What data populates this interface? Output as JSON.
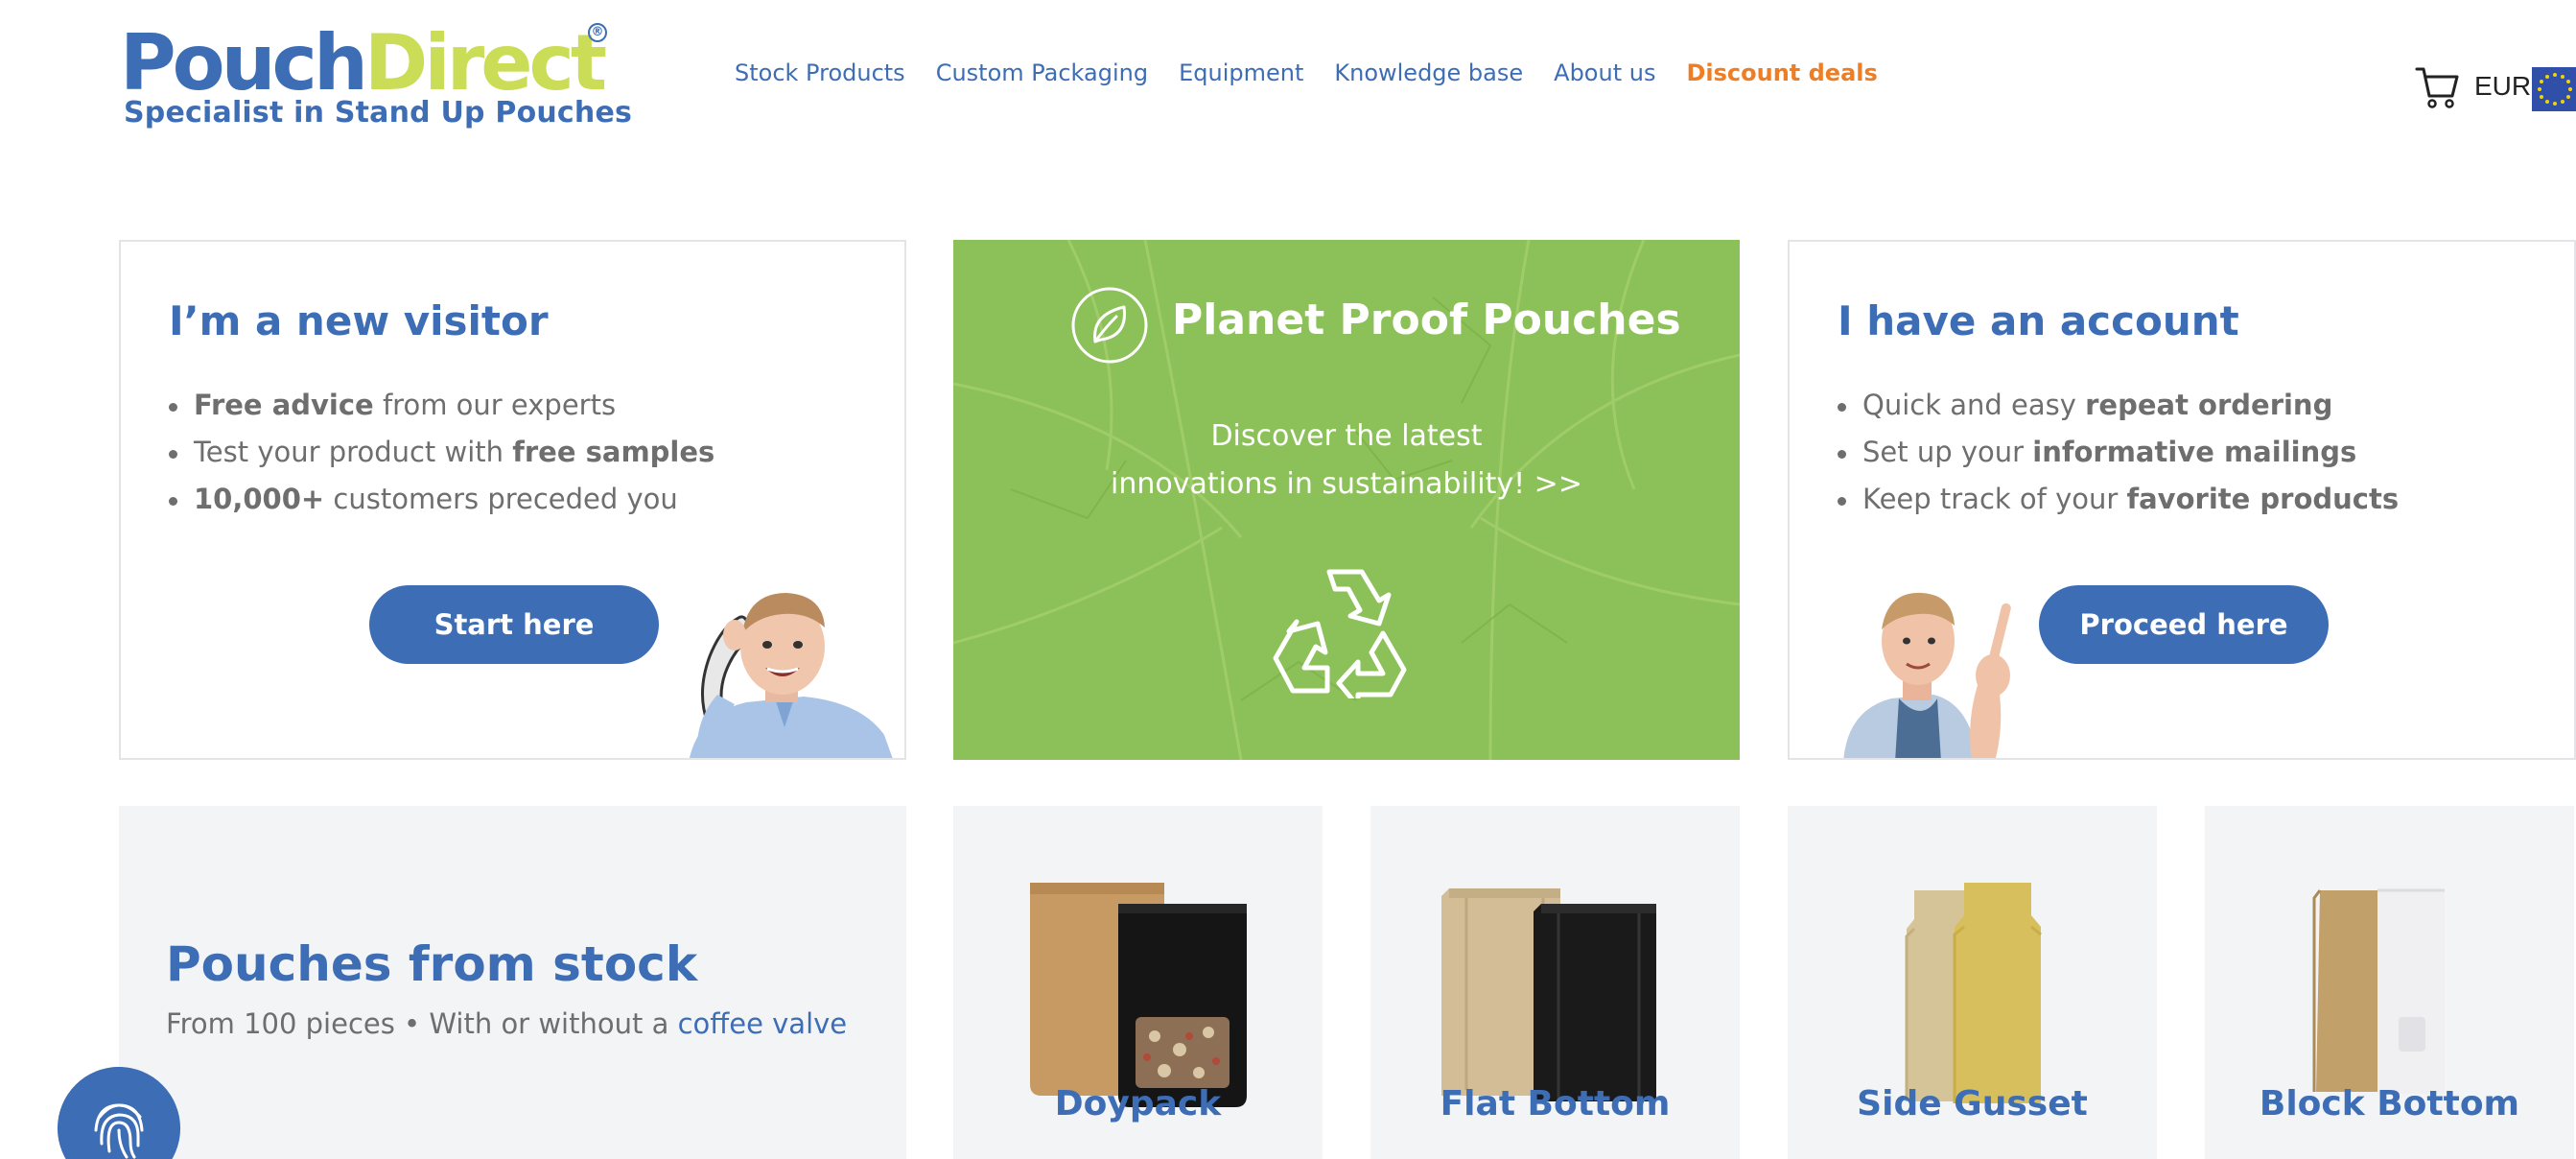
{
  "header": {
    "logo": {
      "word1": "Pouch",
      "word2": "Direct",
      "registered": "®",
      "tagline": "Specialist in Stand Up Pouches"
    },
    "nav": [
      {
        "label": "Stock Products"
      },
      {
        "label": "Custom Packaging"
      },
      {
        "label": "Equipment"
      },
      {
        "label": "Knowledge base"
      },
      {
        "label": "About us"
      },
      {
        "label": "Discount deals"
      }
    ],
    "currency": "EUR"
  },
  "visitor_card": {
    "title": "I’m a new visitor",
    "items": [
      {
        "bold": "Free advice",
        "rest": " from our experts"
      },
      {
        "pre": "Test your product with ",
        "bold": "free samples"
      },
      {
        "bold": "10,000+",
        "rest": " customers preceded you"
      }
    ],
    "button": "Start here"
  },
  "planet_card": {
    "title": "Planet Proof Pouches",
    "subtitle_line1": "Discover the latest",
    "subtitle_line2": "innovations in sustainability! >>"
  },
  "account_card": {
    "title": "I have an account",
    "items": [
      {
        "pre": "Quick and easy ",
        "bold": "repeat ordering"
      },
      {
        "pre": "Set up your ",
        "bold": "informative mailings"
      },
      {
        "pre": "Keep track of your ",
        "bold": "favorite products"
      }
    ],
    "button": "Proceed here"
  },
  "stock": {
    "title": "Pouches from stock",
    "subtitle": "From 100 pieces • With or without a ",
    "subtitle_link": "coffee valve"
  },
  "products": [
    {
      "label": "Doypack"
    },
    {
      "label": "Flat Bottom"
    },
    {
      "label": "Side Gusset"
    },
    {
      "label": "Block Bottom"
    }
  ],
  "colors": {
    "brand_blue": "#3d6db5",
    "brand_green": "#cbdc56",
    "deal_orange": "#ef7d23",
    "leaf_green": "#8fc257",
    "panel_gray": "#f3f4f6"
  },
  "icons": [
    "cart-icon",
    "eu-flag-icon",
    "leaf-icon",
    "recycle-icon",
    "fingerprint-icon"
  ]
}
